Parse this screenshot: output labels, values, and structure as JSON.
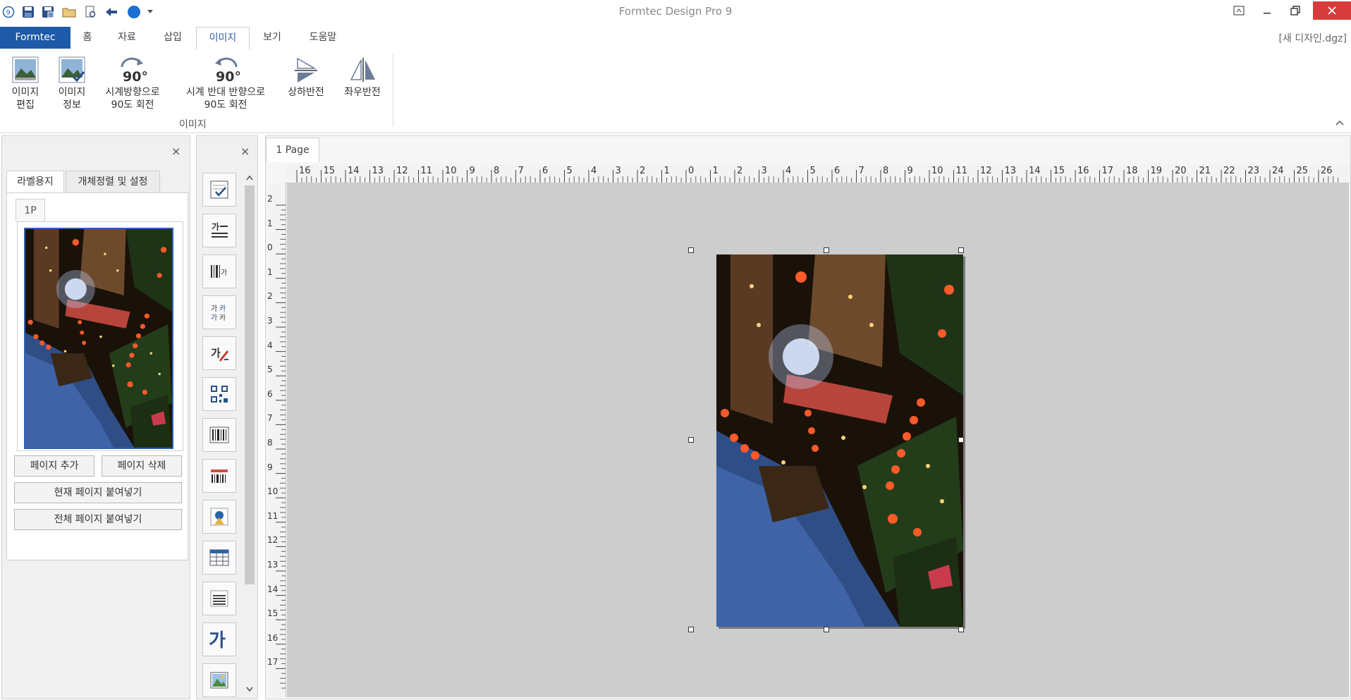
{
  "window": {
    "title": "Formtec Design Pro 9",
    "document_name": "[새 디자인.dgz]"
  },
  "quick_access": {
    "icons": [
      "app-logo-icon",
      "save-icon",
      "save-as-icon",
      "open-folder-icon",
      "print-preview-icon",
      "undo-arrow-icon",
      "blue-circle-icon",
      "dropdown-arrow-icon"
    ]
  },
  "ribbon_tabs": [
    {
      "label": "Formtec"
    },
    {
      "label": "홈"
    },
    {
      "label": "자료"
    },
    {
      "label": "삽입"
    },
    {
      "label": "이미지"
    },
    {
      "label": "보기"
    },
    {
      "label": "도움말"
    }
  ],
  "ribbon": {
    "group_label": "이미지",
    "buttons": [
      {
        "line1": "이미지",
        "line2": "편집",
        "icon": "image-edit-icon"
      },
      {
        "line1": "이미지",
        "line2": "정보",
        "icon": "image-info-icon"
      },
      {
        "line1": "시계방향으로",
        "line2": "90도 회전",
        "icon": "rotate-cw-90-icon",
        "badge": "90°"
      },
      {
        "line1": "시계 반대 반향으로",
        "line2": "90도 회전",
        "icon": "rotate-ccw-90-icon",
        "badge": "90°"
      },
      {
        "line1": "상하반전",
        "line2": "",
        "icon": "flip-vertical-icon"
      },
      {
        "line1": "좌우반전",
        "line2": "",
        "icon": "flip-horizontal-icon"
      }
    ]
  },
  "left_panel": {
    "close": "×",
    "tabs": [
      {
        "label": "라벨용지"
      },
      {
        "label": "개체정렬 및 설정"
      }
    ],
    "page_tab": "1P",
    "buttons": {
      "add_page": "페이지 추가",
      "delete_page": "페이지 삭제",
      "paste_current": "현재 페이지 붙여넣기",
      "paste_all": "전체 페이지 붙여넣기"
    }
  },
  "toolbox": {
    "close": "×",
    "text_tool_glyph": "가",
    "tools": [
      "checkbox-tool-icon",
      "text-box-tool-icon",
      "barcode-text-tool-icon",
      "multi-text-tool-icon",
      "text-style-tool-icon",
      "qr-code-tool-icon",
      "barcode-tool-icon",
      "serial-barcode-tool-icon",
      "image-badge-tool-icon",
      "table-tool-icon",
      "lines-tool-icon",
      "big-text-tool-icon",
      "picture-tool-icon"
    ]
  },
  "document": {
    "page_tab": "1 Page",
    "ruler_h": [
      "16",
      "15",
      "14",
      "13",
      "12",
      "11",
      "10",
      "9",
      "8",
      "7",
      "6",
      "5",
      "4",
      "3",
      "2",
      "1",
      "0",
      "1",
      "2",
      "3",
      "4",
      "5",
      "6",
      "7",
      "8",
      "9",
      "10",
      "11",
      "12",
      "13",
      "14",
      "15",
      "16",
      "17",
      "18",
      "19",
      "20",
      "21",
      "22",
      "23",
      "24",
      "25",
      "26"
    ],
    "ruler_v": [
      "2",
      "1",
      "0",
      "1",
      "2",
      "3",
      "4",
      "5",
      "6",
      "7",
      "8",
      "9",
      "10",
      "11",
      "12",
      "13",
      "14",
      "15",
      "16",
      "17"
    ],
    "image_caption": "image-photo"
  },
  "colors": {
    "formtec_tab": "#1e5aa8",
    "selection_border": "#2f63b3",
    "canvas": "#cdcdcd",
    "close_button": "#d83b3b"
  }
}
